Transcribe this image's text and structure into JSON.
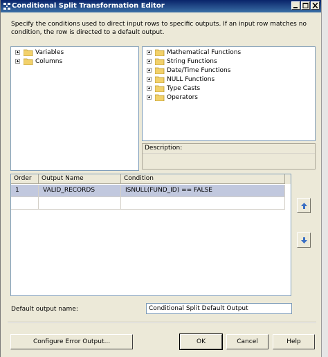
{
  "window": {
    "title": "Conditional Split Transformation Editor",
    "description": "Specify the conditions used to direct input rows to specific outputs. If an input row matches no condition, the row is directed to a default output."
  },
  "left_tree": {
    "items": [
      {
        "label": "Variables",
        "icon": "folder-icon"
      },
      {
        "label": "Columns",
        "icon": "folder-icon"
      }
    ]
  },
  "right_tree": {
    "items": [
      {
        "label": "Mathematical Functions",
        "icon": "folder-icon"
      },
      {
        "label": "String Functions",
        "icon": "folder-icon"
      },
      {
        "label": "Date/Time Functions",
        "icon": "folder-icon"
      },
      {
        "label": "NULL Functions",
        "icon": "folder-icon"
      },
      {
        "label": "Type Casts",
        "icon": "folder-icon"
      },
      {
        "label": "Operators",
        "icon": "folder-icon"
      }
    ]
  },
  "description_panel": {
    "header": "Description:"
  },
  "grid": {
    "columns": [
      "Order",
      "Output Name",
      "Condition"
    ],
    "rows": [
      {
        "order": "1",
        "output_name": "VALID_RECORDS",
        "condition": "ISNULL(FUND_ID) ==  FALSE",
        "selected": true
      }
    ]
  },
  "default_output": {
    "label": "Default output name:",
    "value": "Conditional Split Default Output"
  },
  "buttons": {
    "configure_error": "Configure Error Output...",
    "ok": "OK",
    "cancel": "Cancel",
    "help": "Help"
  },
  "colors": {
    "title_bar": "#0a246a",
    "selected_row": "#c1c8de",
    "folder": "#f2d16b",
    "arrow": "#3a6fc4"
  }
}
